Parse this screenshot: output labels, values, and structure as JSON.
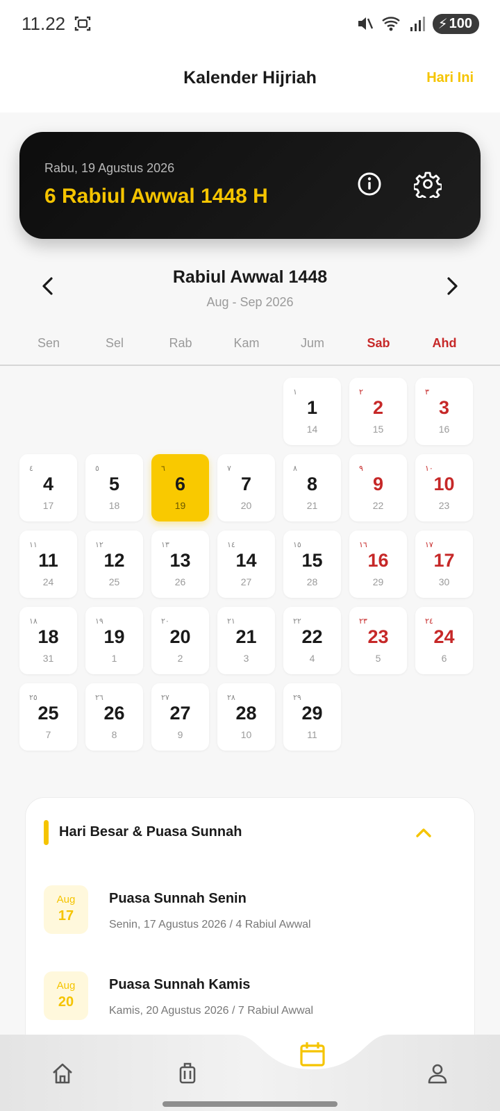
{
  "status": {
    "time": "11.22",
    "battery": "100"
  },
  "header": {
    "title": "Kalender Hijriah",
    "today_label": "Hari Ini"
  },
  "card": {
    "gregorian": "Rabu, 19 Agustus 2026",
    "hijri": "6 Rabiul Awwal 1448 H"
  },
  "month": {
    "title": "Rabiul Awwal 1448",
    "subtitle": "Aug - Sep 2026"
  },
  "weekdays": [
    "Sen",
    "Sel",
    "Rab",
    "Kam",
    "Jum",
    "Sab",
    "Ahd"
  ],
  "days": [
    {
      "ar": "١",
      "h": "1",
      "g": "14"
    },
    {
      "ar": "٢",
      "h": "2",
      "g": "15"
    },
    {
      "ar": "٣",
      "h": "3",
      "g": "16"
    },
    {
      "ar": "٤",
      "h": "4",
      "g": "17"
    },
    {
      "ar": "٥",
      "h": "5",
      "g": "18"
    },
    {
      "ar": "٦",
      "h": "6",
      "g": "19"
    },
    {
      "ar": "٧",
      "h": "7",
      "g": "20"
    },
    {
      "ar": "٨",
      "h": "8",
      "g": "21"
    },
    {
      "ar": "٩",
      "h": "9",
      "g": "22"
    },
    {
      "ar": "١٠",
      "h": "10",
      "g": "23"
    },
    {
      "ar": "١١",
      "h": "11",
      "g": "24"
    },
    {
      "ar": "١٢",
      "h": "12",
      "g": "25"
    },
    {
      "ar": "١٣",
      "h": "13",
      "g": "26"
    },
    {
      "ar": "١٤",
      "h": "14",
      "g": "27"
    },
    {
      "ar": "١٥",
      "h": "15",
      "g": "28"
    },
    {
      "ar": "١٦",
      "h": "16",
      "g": "29"
    },
    {
      "ar": "١٧",
      "h": "17",
      "g": "30"
    },
    {
      "ar": "١٨",
      "h": "18",
      "g": "31"
    },
    {
      "ar": "١٩",
      "h": "19",
      "g": "1"
    },
    {
      "ar": "٢٠",
      "h": "20",
      "g": "2"
    },
    {
      "ar": "٢١",
      "h": "21",
      "g": "3"
    },
    {
      "ar": "٢٢",
      "h": "22",
      "g": "4"
    },
    {
      "ar": "٢٣",
      "h": "23",
      "g": "5"
    },
    {
      "ar": "٢٤",
      "h": "24",
      "g": "6"
    },
    {
      "ar": "٢٥",
      "h": "25",
      "g": "7"
    },
    {
      "ar": "٢٦",
      "h": "26",
      "g": "8"
    },
    {
      "ar": "٢٧",
      "h": "27",
      "g": "9"
    },
    {
      "ar": "٢٨",
      "h": "28",
      "g": "10"
    },
    {
      "ar": "٢٩",
      "h": "29",
      "g": "11"
    }
  ],
  "events": {
    "title": "Hari Besar & Puasa Sunnah",
    "items": [
      {
        "month": "Aug",
        "day": "17",
        "name": "Puasa Sunnah Senin",
        "desc": "Senin, 17 Agustus 2026 / 4 Rabiul Awwal"
      },
      {
        "month": "Aug",
        "day": "20",
        "name": "Puasa Sunnah Kamis",
        "desc": "Kamis, 20 Agustus 2026 / 7 Rabiul Awwal"
      }
    ]
  },
  "colors": {
    "accent": "#f5c400",
    "weekend": "#c62828",
    "card_bg": "#111111"
  },
  "icons": {
    "status": [
      "screenshot-icon",
      "mute-icon",
      "wifi-icon",
      "signal-icon",
      "battery-icon"
    ],
    "card": [
      "info-icon",
      "settings-icon"
    ],
    "nav": [
      "home-icon",
      "luggage-icon",
      "calendar-icon",
      "profile-icon"
    ]
  }
}
